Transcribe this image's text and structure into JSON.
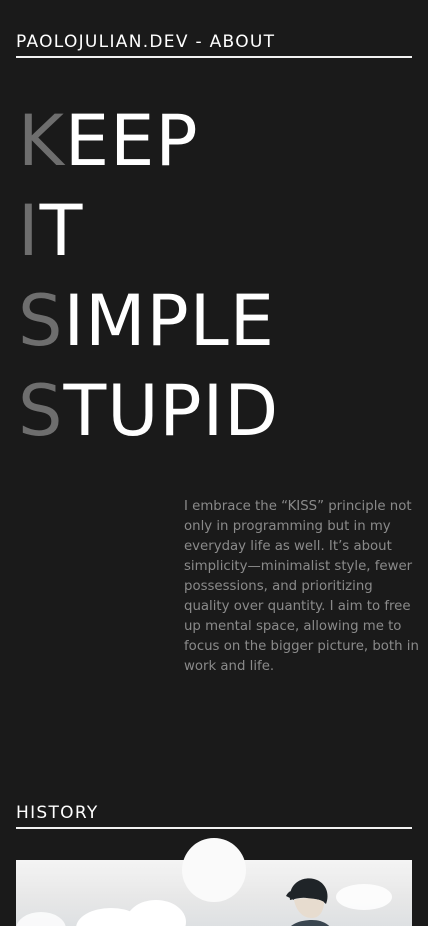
{
  "header": {
    "title": "PAOLOJULIAN.DEV - ABOUT"
  },
  "hero": {
    "lines": [
      {
        "initial": "K",
        "rest": "EEP"
      },
      {
        "initial": "I",
        "rest": "T"
      },
      {
        "initial": "S",
        "rest": "IMPLE"
      },
      {
        "initial": "S",
        "rest": "TUPID"
      }
    ]
  },
  "about": {
    "text": "I embrace the “KISS” principle not only in programming but in my everyday life as well. It’s about simplicity—minimalist style, fewer possessions, and prioritizing quality over quantity. I aim to free up mental space, allowing me to focus on the bigger picture, both in work and life."
  },
  "history": {
    "title": "HISTORY"
  },
  "colors": {
    "background": "#1a1a1a",
    "text": "#ffffff",
    "muted_initial": "#6e6e6e",
    "body_text": "#8a8a8a"
  }
}
